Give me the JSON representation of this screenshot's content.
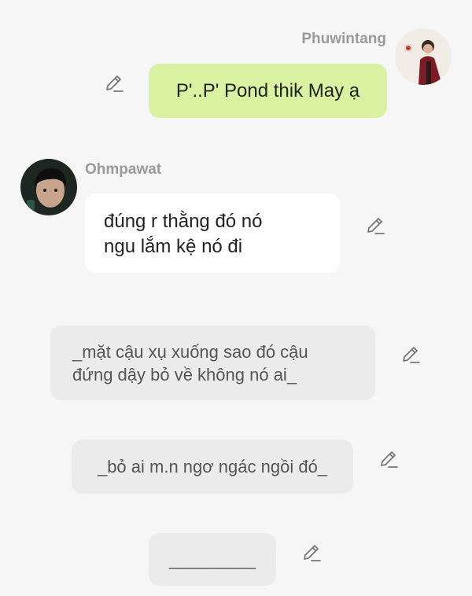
{
  "messages": [
    {
      "sender": "Phuwintang",
      "text": "P'..P' Pond thik May ạ"
    },
    {
      "sender": "Ohmpawat",
      "text": "đúng r thằng đó nó\nngu lắm kệ nó đi"
    }
  ],
  "narration": [
    "_mặt cậu xụ xuống sao đó cậu\nđứng dậy bỏ về không nó ai_",
    "_bỏ ai m.n ngơ ngác ngồi đó_",
    "_________"
  ],
  "icons": {
    "edit": "pencil-edit-icon",
    "avatar_right": "avatar-photo",
    "avatar_left": "avatar-photo"
  },
  "colors": {
    "background": "#f6f6f6",
    "outgoing_bubble": "#d9f2a2",
    "incoming_bubble": "#ffffff",
    "narration_bubble": "#ebebeb",
    "name_text": "#9a9a9a"
  }
}
